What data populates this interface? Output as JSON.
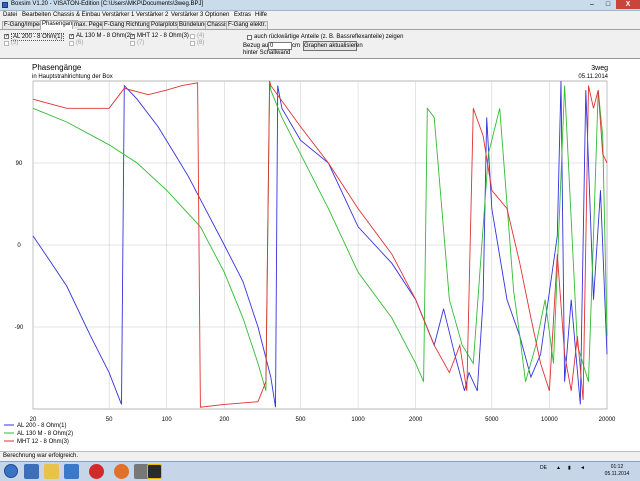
{
  "window": {
    "title": "Boxsim V1.20 - VISATON-Edition [C:\\Users\\MKP\\Documents\\3weg.BPJ]"
  },
  "window_buttons": {
    "minimize": "–",
    "maximize": "□",
    "close": "X"
  },
  "menu": [
    "Datei",
    "Bearbeiten",
    "Chassis & Einbau",
    "Verstärker 1",
    "Verstärker 2",
    "Verstärker 3",
    "Optionen",
    "Extras",
    "Hilfe"
  ],
  "tabs": [
    "F-Gang/Imped.",
    "Phasengang",
    "max. Pegel",
    "F-Gang Richtungen",
    "Polarplots",
    "Bündelung",
    "Chassis",
    "F-Gang elektr."
  ],
  "active_tab": 1,
  "drivers": [
    {
      "label": "AL 200 - 8 Ohm(1)",
      "checked": true
    },
    {
      "label": "AL 130 M - 8 Ohm(2)",
      "checked": true
    },
    {
      "label": "MHT 12 - 8 Ohm(3)",
      "checked": true
    },
    {
      "label": "(4)",
      "checked": false
    },
    {
      "label": "(5)",
      "checked": false
    },
    {
      "label": "(6)",
      "checked": false
    },
    {
      "label": "(7)",
      "checked": false
    },
    {
      "label": "(8)",
      "checked": false
    }
  ],
  "options": {
    "rear_label": "auch rückwärtige Anteile (z. B. Bassreflexanteile) zeigen",
    "ref_label_1": "Bezug auf",
    "ref_label_2": "hinter Schallwand",
    "ref_value": "0",
    "ref_unit": "cm",
    "update_button": "Graphen aktualisieren"
  },
  "status": {
    "text": "Berechnung war erfolgreich."
  },
  "taskbar": {
    "lang": "DE",
    "time": "01:12",
    "date": "05.11.2014"
  },
  "chart_data": {
    "type": "line",
    "title": "Phasengänge",
    "subtitle": "in Hauptstrahlrichtung der Box",
    "project": "3weg",
    "date": "05.11.2014",
    "x_scale": "log",
    "xlim": [
      20,
      20000
    ],
    "ylim": [
      -180,
      180
    ],
    "x_ticks": [
      20,
      50,
      100,
      200,
      500,
      1000,
      2000,
      5000,
      10000,
      20000
    ],
    "y_ticks": [
      90,
      0,
      -90
    ],
    "grid": true,
    "legend_position": "bottom-left",
    "series": [
      {
        "name": "AL 200 - 8 Ohm(1)",
        "color": "#3333dd",
        "points": [
          [
            20,
            10
          ],
          [
            25,
            -20
          ],
          [
            30,
            -45
          ],
          [
            40,
            -100
          ],
          [
            50,
            -140
          ],
          [
            58,
            -175
          ],
          [
            60,
            175
          ],
          [
            70,
            160
          ],
          [
            90,
            130
          ],
          [
            110,
            100
          ],
          [
            130,
            75
          ],
          [
            150,
            50
          ],
          [
            200,
            0
          ],
          [
            250,
            -40
          ],
          [
            300,
            -90
          ],
          [
            350,
            -145
          ],
          [
            370,
            -178
          ],
          [
            380,
            175
          ],
          [
            400,
            150
          ],
          [
            500,
            115
          ],
          [
            700,
            90
          ],
          [
            1000,
            20
          ],
          [
            1500,
            -20
          ],
          [
            2000,
            -60
          ],
          [
            2500,
            -110
          ],
          [
            2800,
            -70
          ],
          [
            3200,
            -120
          ],
          [
            3600,
            -160
          ],
          [
            3800,
            -140
          ],
          [
            4200,
            -160
          ],
          [
            4500,
            -60
          ],
          [
            4700,
            140
          ],
          [
            5000,
            40
          ],
          [
            6000,
            -60
          ],
          [
            7000,
            -100
          ],
          [
            8000,
            -145
          ],
          [
            9000,
            -120
          ],
          [
            11000,
            10
          ],
          [
            11500,
            180
          ],
          [
            12000,
            -150
          ],
          [
            13000,
            -60
          ],
          [
            14500,
            -175
          ],
          [
            15500,
            170
          ],
          [
            17000,
            -60
          ],
          [
            18500,
            60
          ],
          [
            20000,
            -120
          ]
        ]
      },
      {
        "name": "AL 130 M - 8 Ohm(2)",
        "color": "#33bb33",
        "points": [
          [
            20,
            150
          ],
          [
            30,
            135
          ],
          [
            50,
            110
          ],
          [
            70,
            90
          ],
          [
            100,
            60
          ],
          [
            150,
            20
          ],
          [
            200,
            -30
          ],
          [
            250,
            -80
          ],
          [
            300,
            -130
          ],
          [
            330,
            -160
          ],
          [
            345,
            180
          ],
          [
            350,
            170
          ],
          [
            400,
            140
          ],
          [
            500,
            100
          ],
          [
            700,
            40
          ],
          [
            1000,
            -30
          ],
          [
            1500,
            -80
          ],
          [
            2000,
            -130
          ],
          [
            2200,
            -150
          ],
          [
            2300,
            150
          ],
          [
            2500,
            140
          ],
          [
            3000,
            -60
          ],
          [
            3500,
            -110
          ],
          [
            4000,
            -130
          ],
          [
            4800,
            100
          ],
          [
            5500,
            150
          ],
          [
            6500,
            -50
          ],
          [
            7000,
            -100
          ],
          [
            7500,
            -150
          ],
          [
            8500,
            -110
          ],
          [
            9500,
            -60
          ],
          [
            10500,
            -130
          ],
          [
            12000,
            175
          ],
          [
            14000,
            -110
          ],
          [
            16000,
            -150
          ],
          [
            17000,
            10
          ],
          [
            18000,
            170
          ],
          [
            19000,
            120
          ],
          [
            20000,
            -100
          ]
        ]
      },
      {
        "name": "MHT 12 - 8 Ohm(3)",
        "color": "#dd3333",
        "points": [
          [
            20,
            160
          ],
          [
            30,
            150
          ],
          [
            50,
            150
          ],
          [
            60,
            172
          ],
          [
            80,
            165
          ],
          [
            100,
            170
          ],
          [
            120,
            175
          ],
          [
            145,
            178
          ],
          [
            150,
            -178
          ],
          [
            200,
            -175
          ],
          [
            300,
            -172
          ],
          [
            330,
            -150
          ],
          [
            345,
            180
          ],
          [
            350,
            175
          ],
          [
            500,
            130
          ],
          [
            700,
            90
          ],
          [
            1000,
            40
          ],
          [
            1500,
            -10
          ],
          [
            2000,
            -60
          ],
          [
            2500,
            -110
          ],
          [
            3000,
            -140
          ],
          [
            3400,
            -110
          ],
          [
            3700,
            -160
          ],
          [
            4000,
            150
          ],
          [
            4500,
            120
          ],
          [
            5000,
            60
          ],
          [
            6000,
            40
          ],
          [
            7000,
            -20
          ],
          [
            8000,
            -80
          ],
          [
            9000,
            -130
          ],
          [
            10000,
            -160
          ],
          [
            11000,
            -10
          ],
          [
            12000,
            -120
          ],
          [
            13000,
            -160
          ],
          [
            14000,
            -100
          ],
          [
            15000,
            -170
          ],
          [
            16000,
            175
          ],
          [
            17000,
            150
          ],
          [
            18000,
            170
          ],
          [
            19000,
            100
          ],
          [
            20000,
            90
          ]
        ]
      }
    ]
  }
}
